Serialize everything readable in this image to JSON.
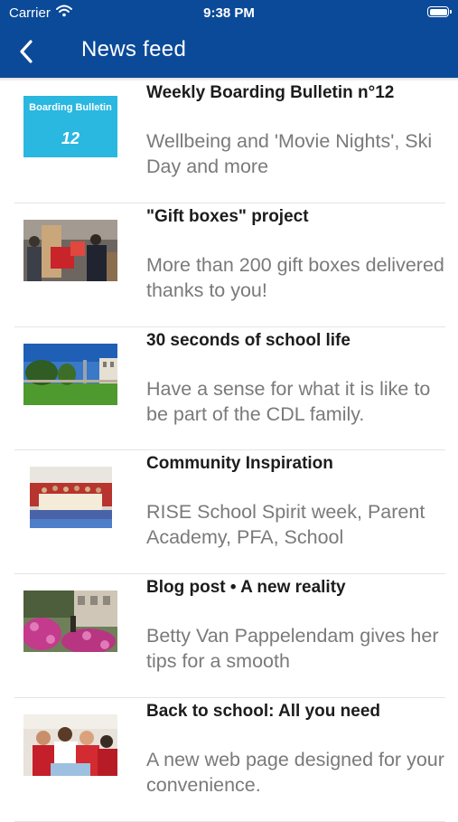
{
  "status_bar": {
    "carrier": "Carrier",
    "time": "9:38 PM"
  },
  "nav": {
    "title": "News feed"
  },
  "feed": [
    {
      "headline": "Weekly Boarding Bulletin n°12",
      "description": "Wellbeing and 'Movie Nights', Ski Day and more",
      "thumb_text": "Boarding Bulletin",
      "thumb_number": "12"
    },
    {
      "headline": "\"Gift boxes\" project",
      "description": "More than 200 gift boxes delivered thanks to you!"
    },
    {
      "headline": "30 seconds of school life",
      "description": "Have a sense for what it is like to be part of the CDL family."
    },
    {
      "headline": "Community Inspiration",
      "description": "RISE School Spirit week, Parent Academy, PFA, School"
    },
    {
      "headline": "Blog post • A new reality",
      "description": "Betty Van Pappelendam gives her tips for a smooth"
    },
    {
      "headline": "Back to school: All you need",
      "description": "A new web page designed for your convenience."
    }
  ]
}
